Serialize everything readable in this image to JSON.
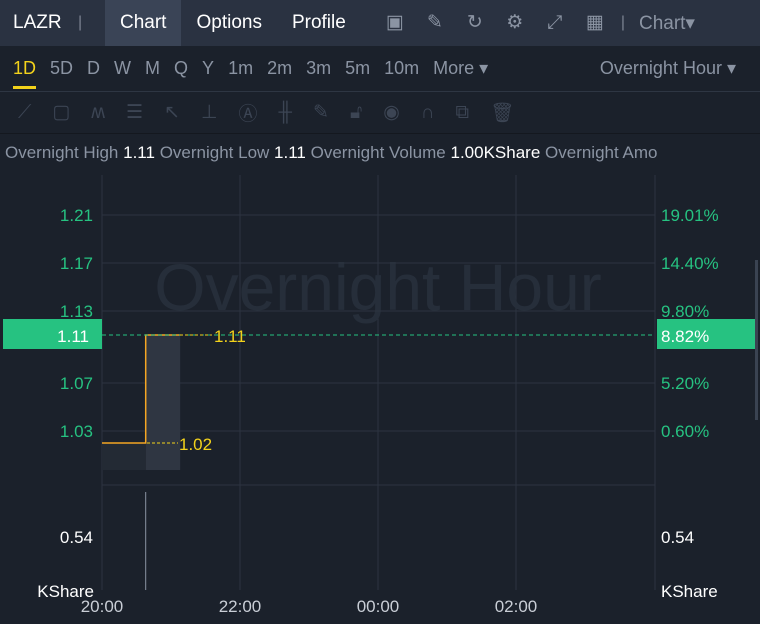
{
  "header": {
    "symbol": "LAZR",
    "tabs": [
      "Chart",
      "Options",
      "Profile"
    ],
    "active_tab": "Chart",
    "icons": [
      "chart-screen-icon",
      "draw-icon",
      "refresh-icon",
      "settings-icon",
      "fullscreen-icon",
      "layout-grid-icon"
    ],
    "chart_type": "Chart▾"
  },
  "periods": {
    "items": [
      "1D",
      "5D",
      "D",
      "W",
      "M",
      "Q",
      "Y",
      "1m",
      "2m",
      "3m",
      "5m",
      "10m",
      "More ▾"
    ],
    "active": "1D",
    "session": "Overnight Hour  ▾"
  },
  "tools": [
    "line-tool-icon",
    "rectangle-tool-icon",
    "pattern-tool-icon",
    "fib-tool-icon",
    "arrow-tool-icon",
    "measure-tool-icon",
    "text-tool-icon",
    "indicator-tool-icon",
    "pencil-icon",
    "lock-icon",
    "eye-icon",
    "magnet-icon",
    "clone-icon",
    "trash-icon"
  ],
  "info": {
    "high_label": "Overnight High",
    "high": "1.11",
    "low_label": "Overnight Low",
    "low": "1.11",
    "vol_label": "Overnight Volume",
    "vol": "1.00KShare",
    "amount_label": "Overnight Amo"
  },
  "chart": {
    "watermark": "Overnight Hour",
    "price_ticks": [
      "1.21",
      "1.17",
      "1.13",
      "1.07",
      "1.03"
    ],
    "pct_ticks": [
      "19.01%",
      "14.40%",
      "9.80%",
      "5.20%",
      "0.60%"
    ],
    "price_tick_values": [
      1.21,
      1.17,
      1.13,
      1.07,
      1.03
    ],
    "current_price": "1.11",
    "current_pct": "8.82%",
    "high_label": "1.11",
    "low_label": "1.02",
    "price_series": [
      [
        "20:00",
        1.02
      ],
      [
        "20:38",
        1.02
      ],
      [
        "20:38",
        1.11
      ],
      [
        "21:08",
        1.11
      ]
    ],
    "volume_tick": "0.54",
    "volume_unit": "KShare",
    "volume_bars": [
      [
        "20:38",
        1.0
      ]
    ],
    "time_ticks": [
      "20:00",
      "22:00",
      "00:00",
      "02:00"
    ],
    "colors": {
      "up": "#26c281",
      "line": "#f5a623",
      "label": "#f3d21b"
    }
  }
}
